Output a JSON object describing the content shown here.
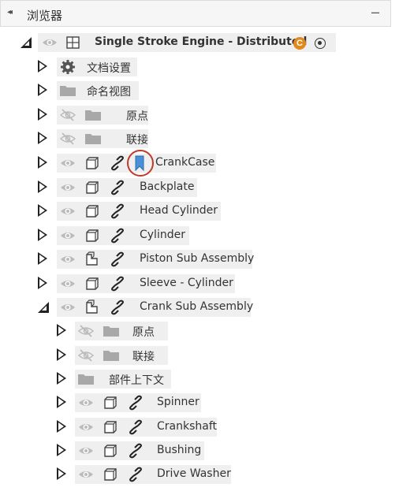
{
  "header": {
    "title": "浏览器",
    "collapse_glyph": "◂◂",
    "minimize_glyph": "–"
  },
  "root": {
    "label": "Single Stroke Engine - Distributed",
    "badge_letter": "C",
    "badge_color": "#e08a1e"
  },
  "tree": [
    {
      "label": "文档设置"
    },
    {
      "label": "命名视图"
    },
    {
      "label": "原点"
    },
    {
      "label": "联接"
    },
    {
      "label": "CrankCase"
    },
    {
      "label": "Backplate"
    },
    {
      "label": "Head Cylinder"
    },
    {
      "label": "Cylinder"
    },
    {
      "label": "Piston Sub Assembly"
    },
    {
      "label": "Sleeve - Cylinder"
    },
    {
      "label": "Crank Sub Assembly"
    },
    {
      "label": "原点"
    },
    {
      "label": "联接"
    },
    {
      "label": "部件上下文"
    },
    {
      "label": "Spinner"
    },
    {
      "label": "Crankshaft"
    },
    {
      "label": "Bushing"
    },
    {
      "label": "Drive Washer"
    }
  ],
  "colors": {
    "row_band": "#efefef",
    "highlight_circle": "#c0392b",
    "bookmark": "#4a90d9"
  }
}
